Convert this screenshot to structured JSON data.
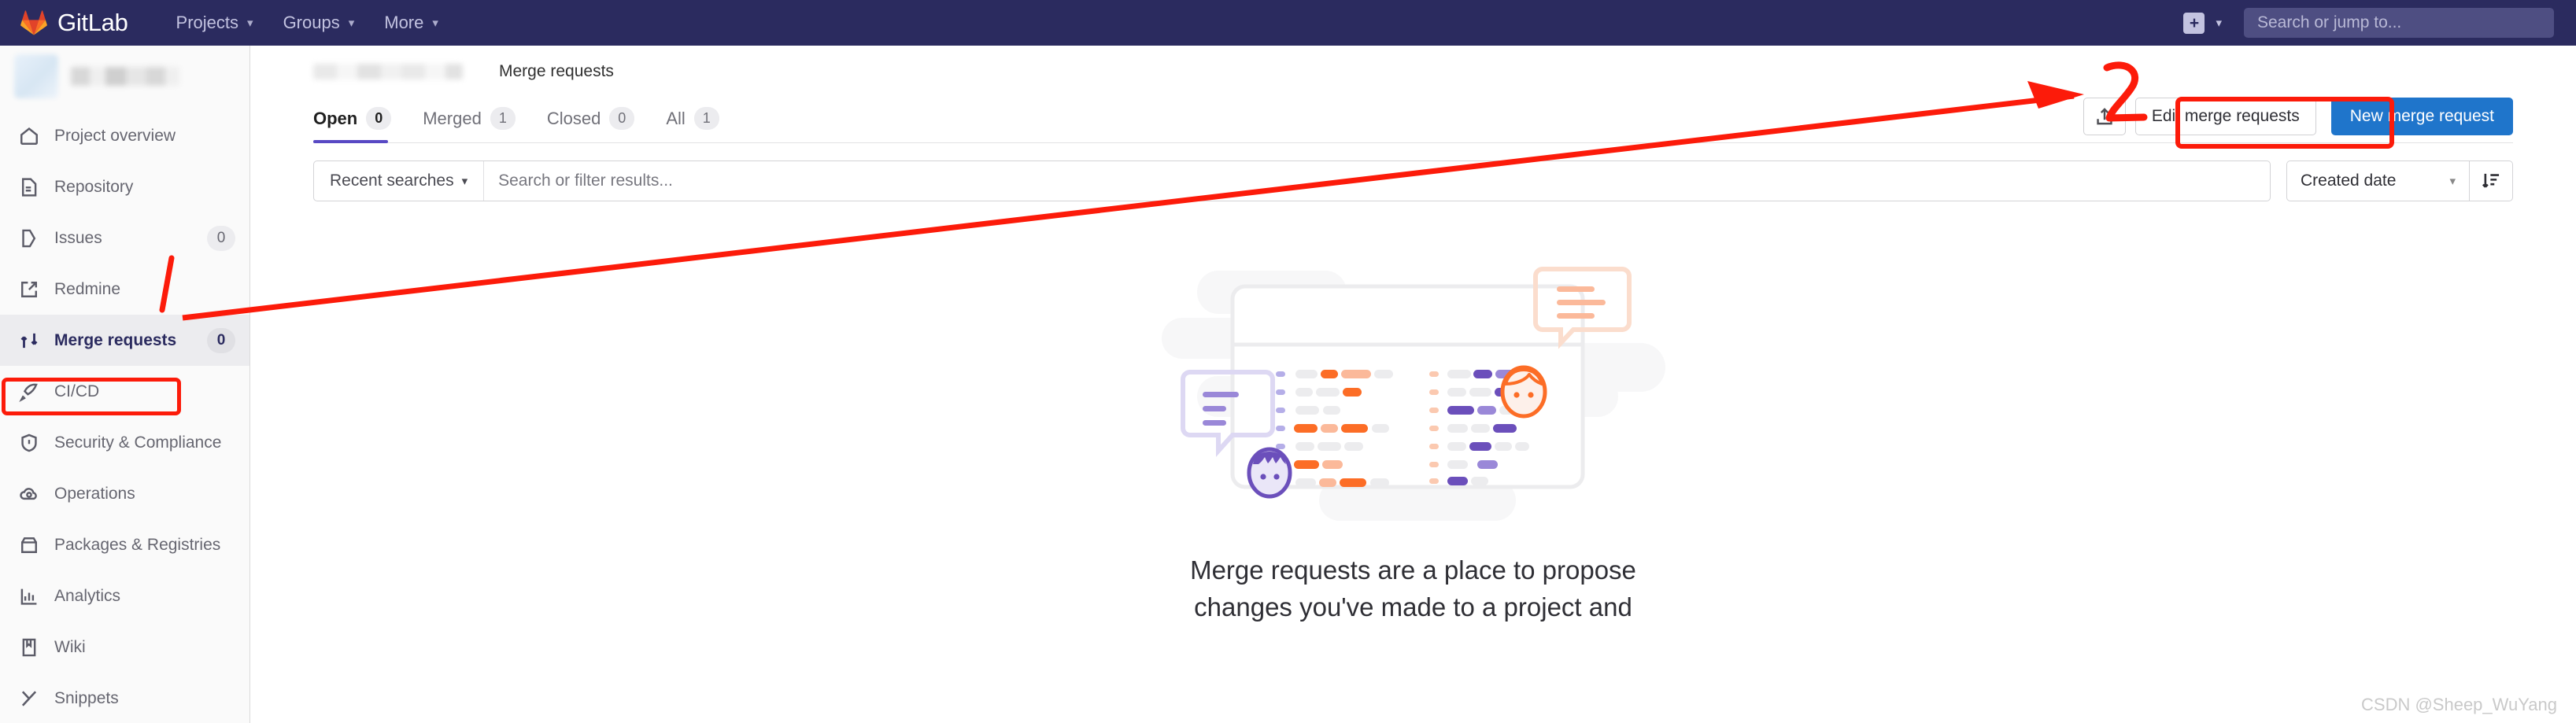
{
  "topbar": {
    "brand": "GitLab",
    "brand_logo_icon": "gitlab-tanuki-logo",
    "nav": [
      {
        "label": "Projects",
        "icon": "chevron-down-icon"
      },
      {
        "label": "Groups",
        "icon": "chevron-down-icon"
      },
      {
        "label": "More",
        "icon": "chevron-down-icon"
      }
    ],
    "new_icon": "plus-square-icon",
    "new_chevron_icon": "chevron-down-icon",
    "search_placeholder": "Search or jump to...",
    "bg_color": "#2b2b5f",
    "text_color": "#c3c3e0"
  },
  "sidebar": {
    "project_name": "",
    "project_avatar_icon": "project-avatar-blurred",
    "items": [
      {
        "label": "Project overview",
        "icon": "home-icon",
        "badge": "",
        "active": false
      },
      {
        "label": "Repository",
        "icon": "document-icon",
        "badge": "",
        "active": false
      },
      {
        "label": "Issues",
        "icon": "issues-icon",
        "badge": "0",
        "active": false
      },
      {
        "label": "Redmine",
        "icon": "external-link-icon",
        "badge": "",
        "active": false
      },
      {
        "label": "Merge requests",
        "icon": "merge-request-icon",
        "badge": "0",
        "active": true
      },
      {
        "label": "CI/CD",
        "icon": "rocket-icon",
        "badge": "",
        "active": false
      },
      {
        "label": "Security & Compliance",
        "icon": "shield-icon",
        "badge": "",
        "active": false
      },
      {
        "label": "Operations",
        "icon": "cloud-gear-icon",
        "badge": "",
        "active": false
      },
      {
        "label": "Packages & Registries",
        "icon": "package-icon",
        "badge": "",
        "active": false
      },
      {
        "label": "Analytics",
        "icon": "chart-bar-icon",
        "badge": "",
        "active": false
      },
      {
        "label": "Wiki",
        "icon": "book-icon",
        "badge": "",
        "active": false
      },
      {
        "label": "Snippets",
        "icon": "snippet-icon",
        "badge": "",
        "active": false
      }
    ]
  },
  "breadcrumb": {
    "project": "",
    "current": "Merge requests"
  },
  "tabs": [
    {
      "label": "Open",
      "count": "0",
      "active": true
    },
    {
      "label": "Merged",
      "count": "1",
      "active": false
    },
    {
      "label": "Closed",
      "count": "0",
      "active": false
    },
    {
      "label": "All",
      "count": "1",
      "active": false
    }
  ],
  "actions": {
    "export_icon": "export-upload-icon",
    "edit_label": "Edit merge requests",
    "new_label": "New merge request",
    "new_button_color": "#1f75cb"
  },
  "filters": {
    "recent_searches_label": "Recent searches",
    "recent_searches_icon": "chevron-down-icon",
    "search_placeholder": "Search or filter results...",
    "search_value": "",
    "sort_value": "Created date",
    "sort_chevron_icon": "chevron-down-icon",
    "sort_direction_icon": "sort-descending-icon"
  },
  "empty_state": {
    "illustration_icon": "merge-requests-empty-illustration",
    "title": "Merge requests are a place to propose changes you've made to a project and"
  },
  "annotations": {
    "highlight_color": "#fc1b0a",
    "sidebar_highlight_target": "Merge requests",
    "button_highlight_target": "New merge request",
    "arrow_description": "arrow from Merge requests sidebar item to New merge request button"
  },
  "watermark": "CSDN @Sheep_WuYang"
}
